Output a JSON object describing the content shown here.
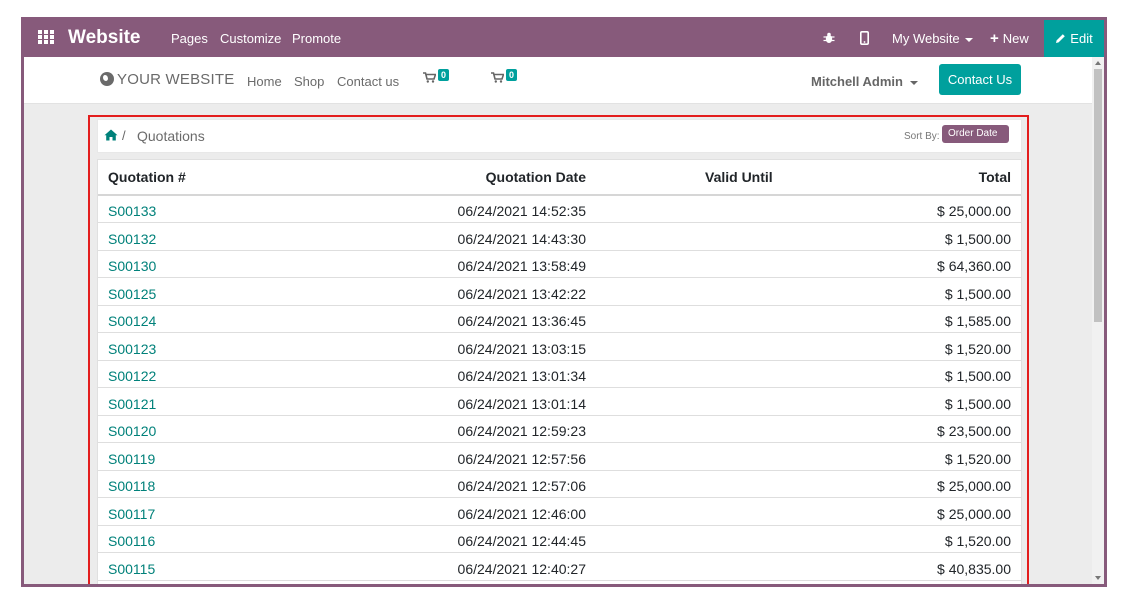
{
  "topbar": {
    "brand": "Website",
    "menus": [
      "Pages",
      "Customize",
      "Promote"
    ],
    "site_selector": "My Website",
    "new_label": "New",
    "edit_label": "Edit"
  },
  "navbar": {
    "logo_text": "YOUR WEBSITE",
    "links": [
      "Home",
      "Shop",
      "Contact us"
    ],
    "cart_counts": [
      "0",
      "0"
    ],
    "user": "Mitchell Admin",
    "contact_button": "Contact Us"
  },
  "breadcrumb": {
    "separator": "/",
    "current": "Quotations",
    "sort_label": "Sort By:",
    "sort_value": "Order Date"
  },
  "table": {
    "headers": [
      "Quotation #",
      "Quotation Date",
      "Valid Until",
      "Total"
    ],
    "rows": [
      {
        "number": "S00133",
        "date": "06/24/2021 14:52:35",
        "valid": "",
        "total": "$ 25,000.00"
      },
      {
        "number": "S00132",
        "date": "06/24/2021 14:43:30",
        "valid": "",
        "total": "$ 1,500.00"
      },
      {
        "number": "S00130",
        "date": "06/24/2021 13:58:49",
        "valid": "",
        "total": "$ 64,360.00"
      },
      {
        "number": "S00125",
        "date": "06/24/2021 13:42:22",
        "valid": "",
        "total": "$ 1,500.00"
      },
      {
        "number": "S00124",
        "date": "06/24/2021 13:36:45",
        "valid": "",
        "total": "$ 1,585.00"
      },
      {
        "number": "S00123",
        "date": "06/24/2021 13:03:15",
        "valid": "",
        "total": "$ 1,520.00"
      },
      {
        "number": "S00122",
        "date": "06/24/2021 13:01:34",
        "valid": "",
        "total": "$ 1,500.00"
      },
      {
        "number": "S00121",
        "date": "06/24/2021 13:01:14",
        "valid": "",
        "total": "$ 1,500.00"
      },
      {
        "number": "S00120",
        "date": "06/24/2021 12:59:23",
        "valid": "",
        "total": "$ 23,500.00"
      },
      {
        "number": "S00119",
        "date": "06/24/2021 12:57:56",
        "valid": "",
        "total": "$ 1,520.00"
      },
      {
        "number": "S00118",
        "date": "06/24/2021 12:57:06",
        "valid": "",
        "total": "$ 25,000.00"
      },
      {
        "number": "S00117",
        "date": "06/24/2021 12:46:00",
        "valid": "",
        "total": "$ 25,000.00"
      },
      {
        "number": "S00116",
        "date": "06/24/2021 12:44:45",
        "valid": "",
        "total": "$ 1,520.00"
      },
      {
        "number": "S00115",
        "date": "06/24/2021 12:40:27",
        "valid": "",
        "total": "$ 40,835.00"
      }
    ]
  },
  "colors": {
    "brand_purple": "#875a7b",
    "accent_teal": "#00a09d",
    "link_teal": "#00817a",
    "highlight_red": "#e31d1d"
  }
}
